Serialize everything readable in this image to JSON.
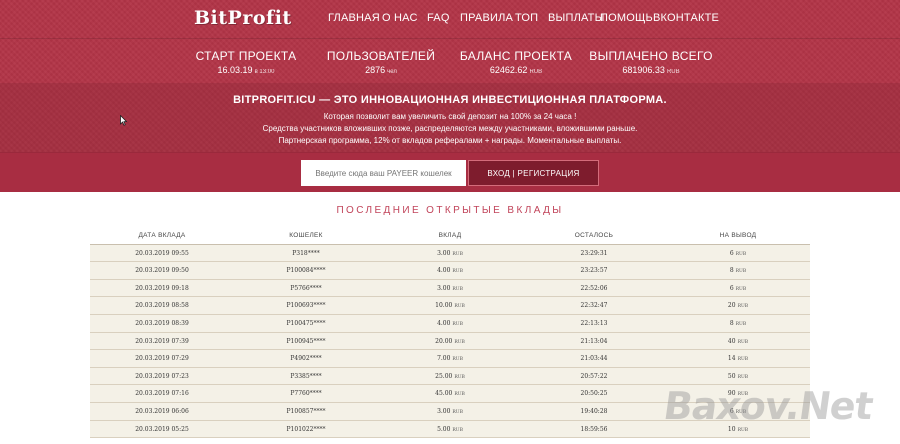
{
  "header": {
    "logo": "BitProfit",
    "nav": [
      "ГЛАВНАЯ",
      "О НАС",
      "FAQ",
      "ПРАВИЛА",
      "ТОП",
      "ВЫПЛАТЫ",
      "ПОМОЩЬ",
      "ВКОНТАКТЕ"
    ],
    "stats": [
      {
        "title": "СТАРТ ПРОЕКТА",
        "value": "16.03.19",
        "unit": "в 13:00"
      },
      {
        "title": "ПОЛЬЗОВАТЕЛЕЙ",
        "value": "2876",
        "unit": "чел"
      },
      {
        "title": "БАЛАНС ПРОЕКТА",
        "value": "62462.62",
        "unit": "RUB"
      },
      {
        "title": "ВЫПЛАЧЕНО ВСЕГО",
        "value": "681906.33",
        "unit": "RUB"
      }
    ],
    "info": {
      "title": "BITPROFIT.ICU — ЭТО ИННОВАЦИОННАЯ ИНВЕСТИЦИОННАЯ ПЛАТФОРМА.",
      "lines": [
        "Которая позволит вам увеличить свой депозит на 100% за 24 часа !",
        "Средства участников вложивших позже, распределяются между участниками, вложившими раньше.",
        "Партнерская программа, 12% от вкладов рефералами + награды. Моментальные выплаты."
      ]
    },
    "form": {
      "wallet_placeholder": "Введите сюда ваш PAYEER кошелек",
      "login_label": "ВХОД | РЕГИСТРАЦИЯ"
    }
  },
  "deposits": {
    "title": "ПОСЛЕДНИЕ ОТКРЫТЫЕ ВКЛАДЫ",
    "columns": [
      "ДАТА ВКЛАДА",
      "КОШЕЛЕК",
      "ВКЛАД",
      "ОСТАЛОСЬ",
      "НА ВЫВОД"
    ],
    "currency": "RUB",
    "rows": [
      {
        "date": "20.03.2019 09:55",
        "wallet": "P318****",
        "amount": "3.00",
        "left": "23:29:31",
        "payout": "6"
      },
      {
        "date": "20.03.2019 09:50",
        "wallet": "P100084****",
        "amount": "4.00",
        "left": "23:23:57",
        "payout": "8"
      },
      {
        "date": "20.03.2019 09:18",
        "wallet": "P5766****",
        "amount": "3.00",
        "left": "22:52:06",
        "payout": "6"
      },
      {
        "date": "20.03.2019 08:58",
        "wallet": "P100693****",
        "amount": "10.00",
        "left": "22:32:47",
        "payout": "20"
      },
      {
        "date": "20.03.2019 08:39",
        "wallet": "P100475****",
        "amount": "4.00",
        "left": "22:13:13",
        "payout": "8"
      },
      {
        "date": "20.03.2019 07:39",
        "wallet": "P100945****",
        "amount": "20.00",
        "left": "21:13:04",
        "payout": "40"
      },
      {
        "date": "20.03.2019 07:29",
        "wallet": "P4902****",
        "amount": "7.00",
        "left": "21:03:44",
        "payout": "14"
      },
      {
        "date": "20.03.2019 07:23",
        "wallet": "P3385****",
        "amount": "25.00",
        "left": "20:57:22",
        "payout": "50"
      },
      {
        "date": "20.03.2019 07:16",
        "wallet": "P7760****",
        "amount": "45.00",
        "left": "20:50:25",
        "payout": "90"
      },
      {
        "date": "20.03.2019 06:06",
        "wallet": "P100857****",
        "amount": "3.00",
        "left": "19:40:28",
        "payout": "6"
      },
      {
        "date": "20.03.2019 05:25",
        "wallet": "P101022****",
        "amount": "5.00",
        "left": "18:59:56",
        "payout": "10"
      }
    ]
  },
  "watermark": "Baxov.Net",
  "colors": {
    "brand": "#b23447",
    "button": "#7e1c2d",
    "title": "#c1445a",
    "row": "#f4f1e7"
  }
}
